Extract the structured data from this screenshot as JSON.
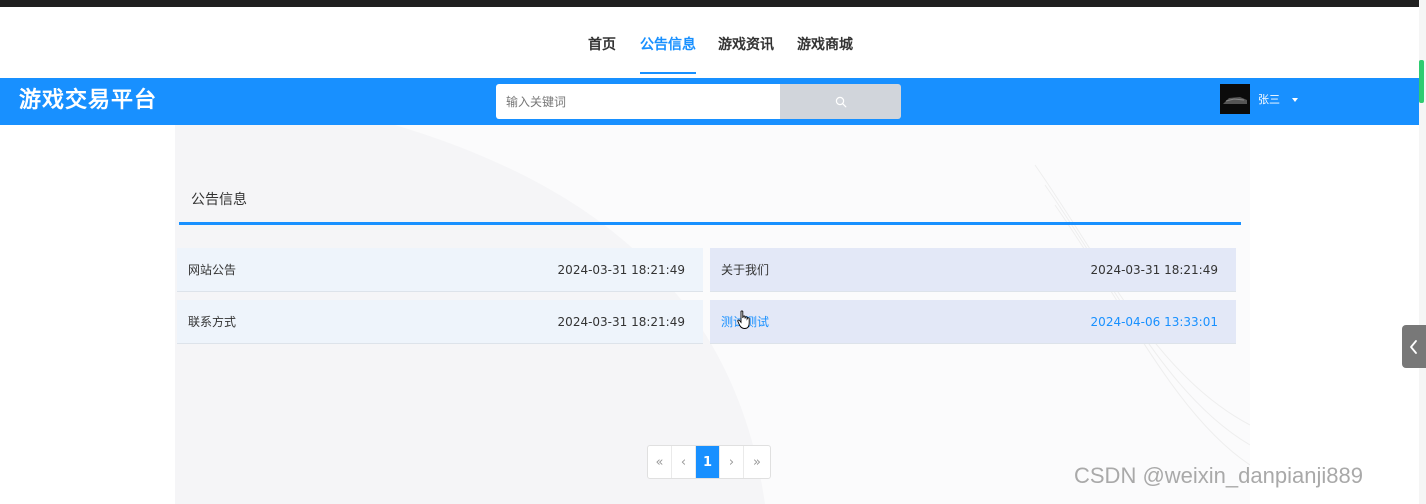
{
  "top_nav": {
    "items": [
      {
        "label": "首页",
        "active": false
      },
      {
        "label": "公告信息",
        "active": true
      },
      {
        "label": "游戏资讯",
        "active": false
      },
      {
        "label": "游戏商城",
        "active": false
      }
    ]
  },
  "header": {
    "logo": "游戏交易平台",
    "search_placeholder": "输入关键词",
    "search_icon": "search-icon",
    "user_name": "张三",
    "brand_color": "#1890ff"
  },
  "main": {
    "section_title": "公告信息",
    "notices": [
      {
        "title": "网站公告",
        "time": "2024-03-31 18:21:49"
      },
      {
        "title": "关于我们",
        "time": "2024-03-31 18:21:49"
      },
      {
        "title": "联系方式",
        "time": "2024-03-31 18:21:49"
      },
      {
        "title": "测试测试",
        "time": "2024-04-06 13:33:01"
      }
    ]
  },
  "pagination": {
    "first": "«",
    "prev": "‹",
    "current": "1",
    "next": "›",
    "last": "»"
  },
  "watermark": "CSDN @weixin_danpianji889"
}
